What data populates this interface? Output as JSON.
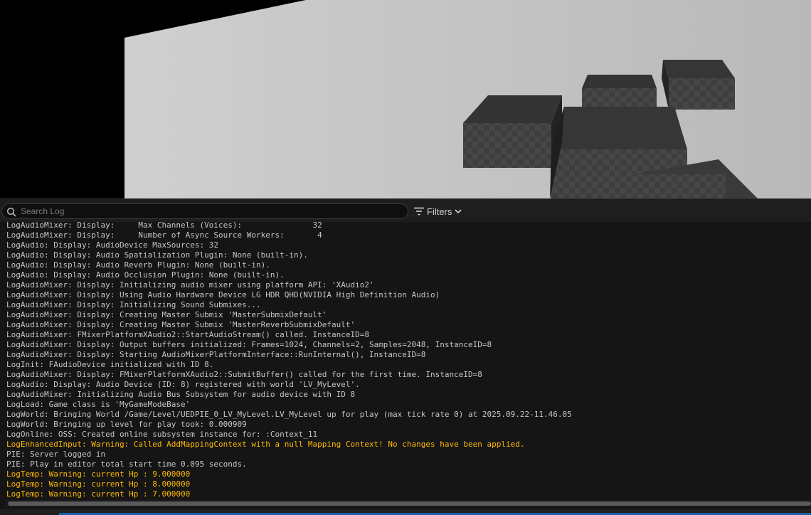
{
  "viewport": {
    "description_icon": "3d-scene"
  },
  "toolbar": {
    "search_placeholder": "Search Log",
    "filters_label": "Filters",
    "search_icon": "search-icon",
    "filters_icon": "filter-icon",
    "chevron_icon": "chevron-down-icon"
  },
  "colors": {
    "normal_text": "#c6c6c6",
    "warning_text": "#ffb900",
    "panel_bg": "#151515",
    "accent": "#1b5fa8"
  },
  "log": {
    "lines": [
      {
        "text": "LogAudioMixer: Display:     Max Channels (Voices):               32",
        "level": "normal"
      },
      {
        "text": "LogAudioMixer: Display:     Number of Async Source Workers:       4",
        "level": "normal"
      },
      {
        "text": "LogAudio: Display: AudioDevice MaxSources: 32",
        "level": "normal"
      },
      {
        "text": "LogAudio: Display: Audio Spatialization Plugin: None (built-in).",
        "level": "normal"
      },
      {
        "text": "LogAudio: Display: Audio Reverb Plugin: None (built-in).",
        "level": "normal"
      },
      {
        "text": "LogAudio: Display: Audio Occlusion Plugin: None (built-in).",
        "level": "normal"
      },
      {
        "text": "LogAudioMixer: Display: Initializing audio mixer using platform API: 'XAudio2'",
        "level": "normal"
      },
      {
        "text": "LogAudioMixer: Display: Using Audio Hardware Device LG HDR QHD(NVIDIA High Definition Audio)",
        "level": "normal"
      },
      {
        "text": "LogAudioMixer: Display: Initializing Sound Submixes...",
        "level": "normal"
      },
      {
        "text": "LogAudioMixer: Display: Creating Master Submix 'MasterSubmixDefault'",
        "level": "normal"
      },
      {
        "text": "LogAudioMixer: Display: Creating Master Submix 'MasterReverbSubmixDefault'",
        "level": "normal"
      },
      {
        "text": "LogAudioMixer: FMixerPlatformXAudio2::StartAudioStream() called. InstanceID=8",
        "level": "normal"
      },
      {
        "text": "LogAudioMixer: Display: Output buffers initialized: Frames=1024, Channels=2, Samples=2048, InstanceID=8",
        "level": "normal"
      },
      {
        "text": "LogAudioMixer: Display: Starting AudioMixerPlatformInterface::RunInternal(), InstanceID=8",
        "level": "normal"
      },
      {
        "text": "LogInit: FAudioDevice initialized with ID 8.",
        "level": "normal"
      },
      {
        "text": "LogAudioMixer: Display: FMixerPlatformXAudio2::SubmitBuffer() called for the first time. InstanceID=8",
        "level": "normal"
      },
      {
        "text": "LogAudio: Display: Audio Device (ID: 8) registered with world 'LV_MyLevel'.",
        "level": "normal"
      },
      {
        "text": "LogAudioMixer: Initializing Audio Bus Subsystem for audio device with ID 8",
        "level": "normal"
      },
      {
        "text": "LogLoad: Game class is 'MyGameModeBase'",
        "level": "normal"
      },
      {
        "text": "LogWorld: Bringing World /Game/Level/UEDPIE_0_LV_MyLevel.LV_MyLevel up for play (max tick rate 0) at 2025.09.22-11.46.05",
        "level": "normal"
      },
      {
        "text": "LogWorld: Bringing up level for play took: 0.000909",
        "level": "normal"
      },
      {
        "text": "LogOnline: OSS: Created online subsystem instance for: :Context_11",
        "level": "normal"
      },
      {
        "text": "LogEnhancedInput: Warning: Called AddMappingContext with a null Mapping Context! No changes have been applied.",
        "level": "warning"
      },
      {
        "text": "PIE: Server logged in",
        "level": "normal"
      },
      {
        "text": "PIE: Play in editor total start time 0.095 seconds.",
        "level": "normal"
      },
      {
        "text": "LogTemp: Warning: current Hp : 9.000000",
        "level": "warning"
      },
      {
        "text": "LogTemp: Warning: current Hp : 8.000000",
        "level": "warning"
      },
      {
        "text": "LogTemp: Warning: current Hp : 7.000000",
        "level": "warning"
      }
    ]
  }
}
